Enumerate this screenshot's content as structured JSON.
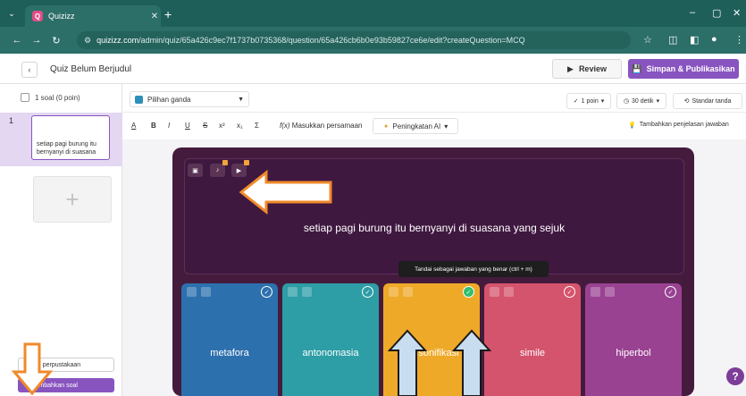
{
  "browser": {
    "tab_title": "Quizizz",
    "favicon_letter": "Q",
    "url_host": "quizizz.com",
    "url_path": "/admin/quiz/65a426c9ec7f1737b0735368/question/65a426cb6b0e93b59827ce6e/edit?createQuestion=MCQ"
  },
  "header": {
    "quiz_title": "Quiz Belum Berjudul",
    "review_label": "Review",
    "publish_label": "Simpan & Publikasikan"
  },
  "sidebar": {
    "count_label": "1 soal  (0 poin)",
    "slide_number": "1",
    "slide_preview": "setiap pagi burung itu bernyanyi di suasana",
    "library_label": "Cari perpustakaan",
    "add_question_label": "Tambahkan soal"
  },
  "toolbar": {
    "question_type": "Pilihan ganda",
    "points": "1 poin",
    "time": "30 detik",
    "tags": "Standar tanda",
    "equation_label": "Masukkan persamaan",
    "ai_label": "Peningkatan AI",
    "explanation_label": "Tambahkan penjelasan jawaban",
    "format_buttons": [
      "A",
      "B",
      "I",
      "U",
      "S",
      "x²",
      "x₁",
      "Σ"
    ]
  },
  "question": {
    "text": "setiap pagi burung itu bernyanyi di suasana yang sejuk",
    "tooltip": "Tandai sebagai jawaban yang benar (ctrl + m)"
  },
  "options": [
    {
      "text": "metafora",
      "color": "#2d70ae",
      "correct": false
    },
    {
      "text": "antonomasia",
      "color": "#2d9da6",
      "correct": false
    },
    {
      "text": "personifikasi",
      "color": "#efa929",
      "correct": true
    },
    {
      "text": "simile",
      "color": "#d5546d",
      "correct": false
    },
    {
      "text": "hiperbol",
      "color": "#9a4292",
      "correct": false
    }
  ],
  "help_label": "?"
}
